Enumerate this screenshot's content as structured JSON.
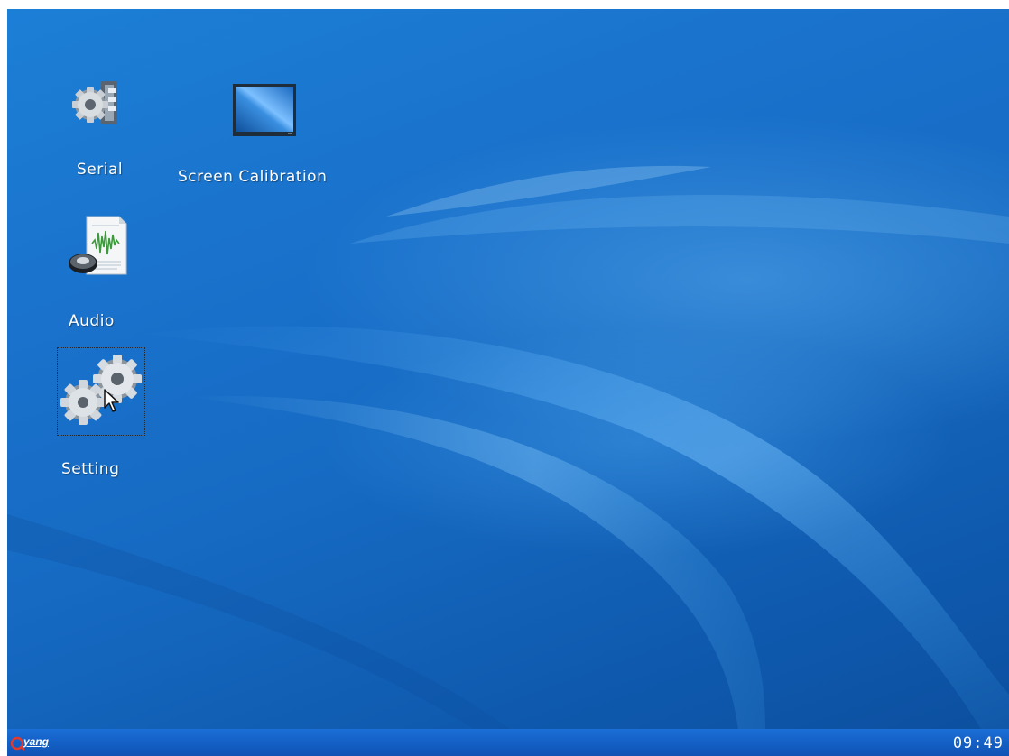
{
  "desktop": {
    "icons": [
      {
        "label": "Serial",
        "icon": "serial-gear-icon"
      },
      {
        "label": "Screen Calibration",
        "icon": "monitor-icon"
      },
      {
        "label": "Audio",
        "icon": "audio-speaker-icon"
      },
      {
        "label": "Setting",
        "icon": "settings-gears-icon",
        "selected": true
      }
    ]
  },
  "taskbar": {
    "start_logo_text": "yang",
    "clock": "09:49"
  },
  "colors": {
    "wallpaper": "#1a72cc",
    "taskbar": "#1460c6",
    "text": "#ffffff"
  }
}
